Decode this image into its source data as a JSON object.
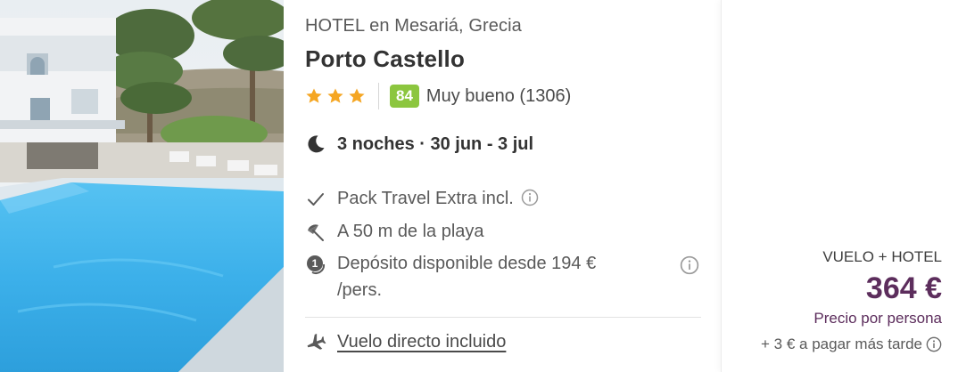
{
  "hotel": {
    "type_location": "HOTEL en Mesariá, Grecia",
    "name": "Porto Castello",
    "stars": 3,
    "score": "84",
    "score_label": "Muy bueno (1306)"
  },
  "stay": {
    "text": "3 noches · 30 jun - 3 jul"
  },
  "features": [
    {
      "icon": "check-icon",
      "text": "Pack Travel Extra incl."
    },
    {
      "icon": "beach-umbrella-icon",
      "text": "A 50 m de la playa"
    },
    {
      "icon": "deposit-icon",
      "text": "Depósito disponible desde 194 € /pers."
    }
  ],
  "flight": {
    "text": "Vuelo directo incluido"
  },
  "price": {
    "package_label": "VUELO + HOTEL",
    "amount": "364 €",
    "per_person": "Precio por persona",
    "extra": "+ 3 € a pagar más tarde"
  },
  "colors": {
    "star": "#f5a623",
    "score_badge": "#8cc63f",
    "price": "#5c2d5c",
    "pool": "#45b6ee"
  }
}
